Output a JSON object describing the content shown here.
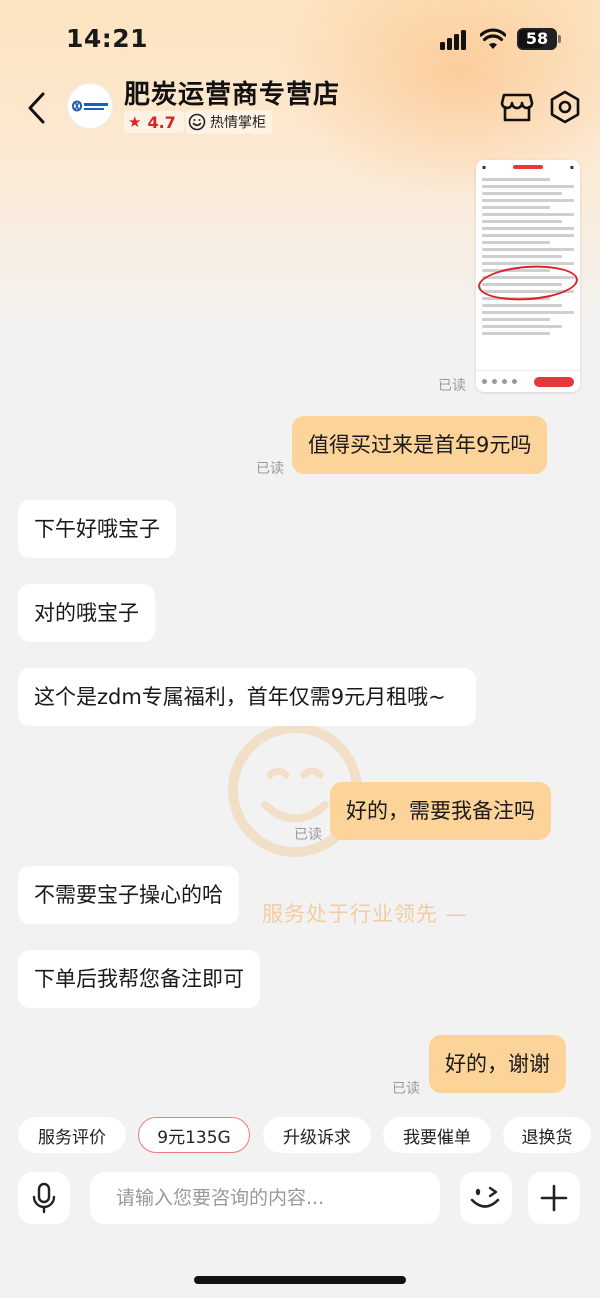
{
  "status_bar": {
    "time": "14:21",
    "battery": "58"
  },
  "header": {
    "shop_name": "肥炭运营商专营店",
    "rating": "4.7",
    "badge": "热情掌柜",
    "logo_icon": "china-telecom-logo"
  },
  "chat": {
    "read_label": "已读",
    "messages": [
      {
        "side": "right",
        "text": "值得买过来是首年9元吗"
      },
      {
        "side": "left",
        "text": "下午好哦宝子"
      },
      {
        "side": "left",
        "text": "对的哦宝子"
      },
      {
        "side": "left",
        "text": "这个是zdm专属福利，首年仅需9元月租哦~"
      },
      {
        "side": "right",
        "text": "好的，需要我备注吗"
      },
      {
        "side": "left",
        "text": "不需要宝子操心的哈"
      },
      {
        "side": "left",
        "text": "下单后我帮您备注即可"
      },
      {
        "side": "right",
        "text": "好的，谢谢"
      }
    ]
  },
  "watermark": {
    "text": "服务处于行业领先 —"
  },
  "quick_actions": [
    "服务评价",
    "9元135G",
    "升级诉求",
    "我要催单",
    "退换货"
  ],
  "input": {
    "placeholder": "请输入您要咨询的内容..."
  },
  "colors": {
    "accent_red": "#d8232a",
    "bubble_right": "#fcd398",
    "chip_highlight": "#f27b7b"
  }
}
